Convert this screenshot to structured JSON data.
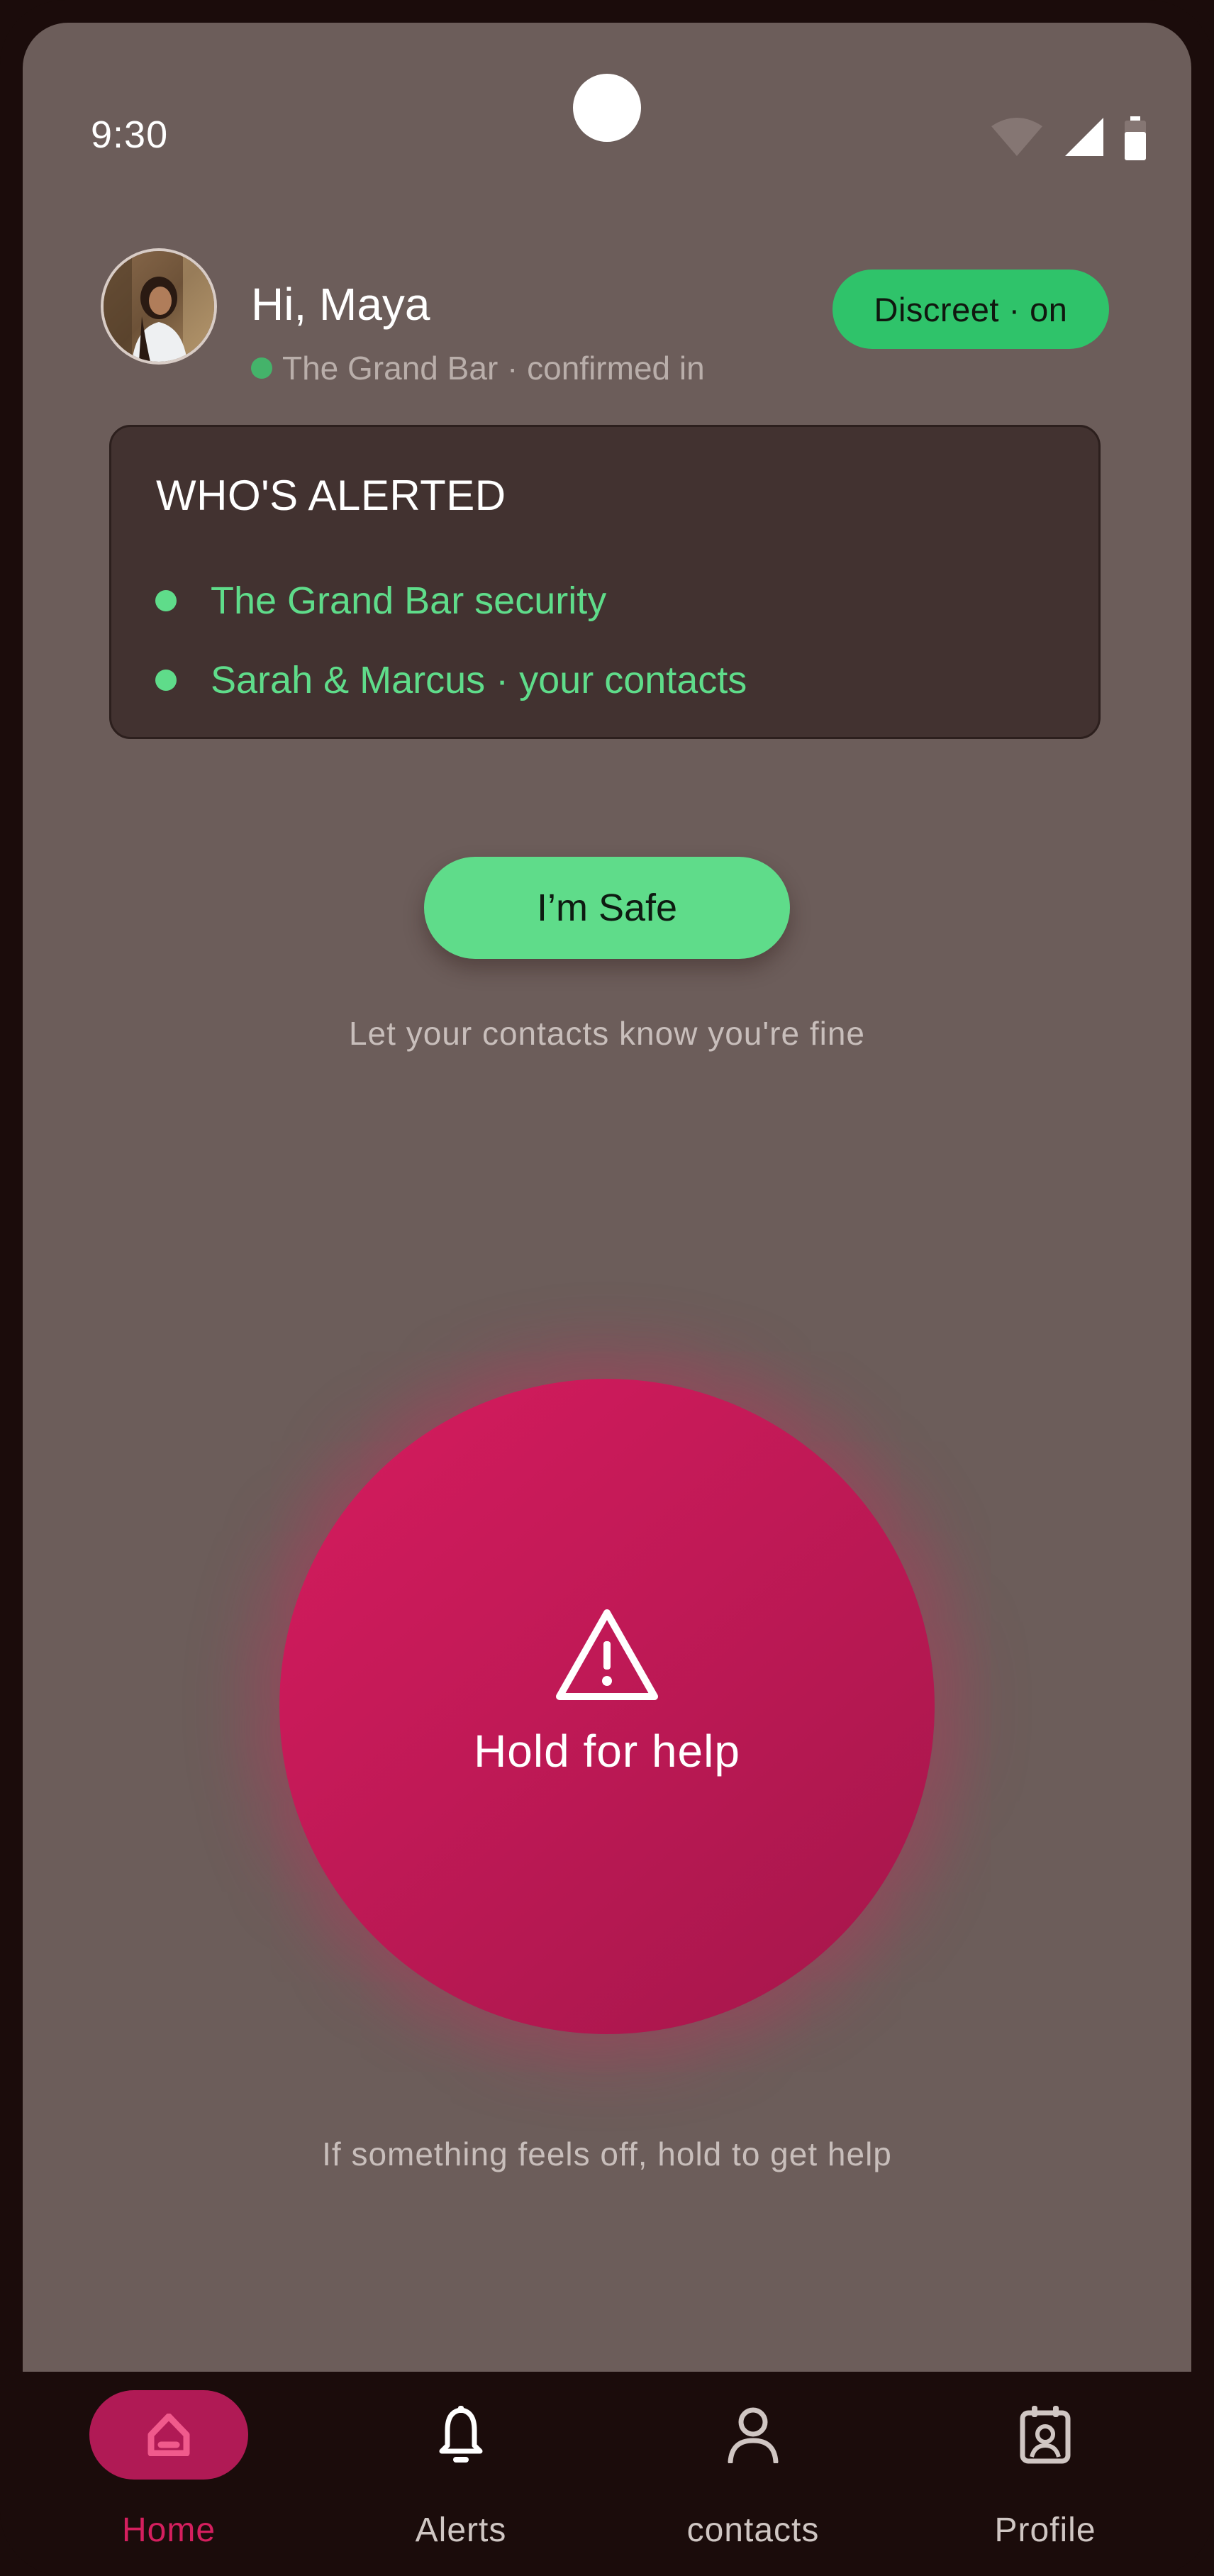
{
  "status_bar": {
    "time": "9:30",
    "icons": [
      "wifi-icon",
      "cellular-signal-icon",
      "battery-icon"
    ]
  },
  "header": {
    "greeting": "Hi, Maya",
    "venue_status": "The Grand Bar · confirmed in",
    "venue_status_color": "#44b36a",
    "discreet_label": "Discreet · on"
  },
  "alert_card": {
    "title": "WHO'S ALERTED",
    "items": [
      {
        "label": "The Grand Bar security"
      },
      {
        "label": "Sarah & Marcus · your contacts"
      }
    ]
  },
  "safe": {
    "button_label": "I’m Safe",
    "hint": "Let your contacts know you're fine"
  },
  "help": {
    "button_label": "Hold for help",
    "hint": "If something feels off, hold to get help"
  },
  "nav": {
    "items": [
      {
        "label": "Home",
        "icon": "home-icon",
        "active": true
      },
      {
        "label": "Alerts",
        "icon": "bell-icon",
        "active": false
      },
      {
        "label": "contacts",
        "icon": "person-icon",
        "active": false
      },
      {
        "label": "Profile",
        "icon": "profile-badge-icon",
        "active": false
      }
    ]
  },
  "colors": {
    "background": "#6c5d5a",
    "accent_green": "#5fdc8a",
    "discreet_green": "#2fc36a",
    "help_pink": "#c01956",
    "nav_active": "#d41f5e"
  }
}
